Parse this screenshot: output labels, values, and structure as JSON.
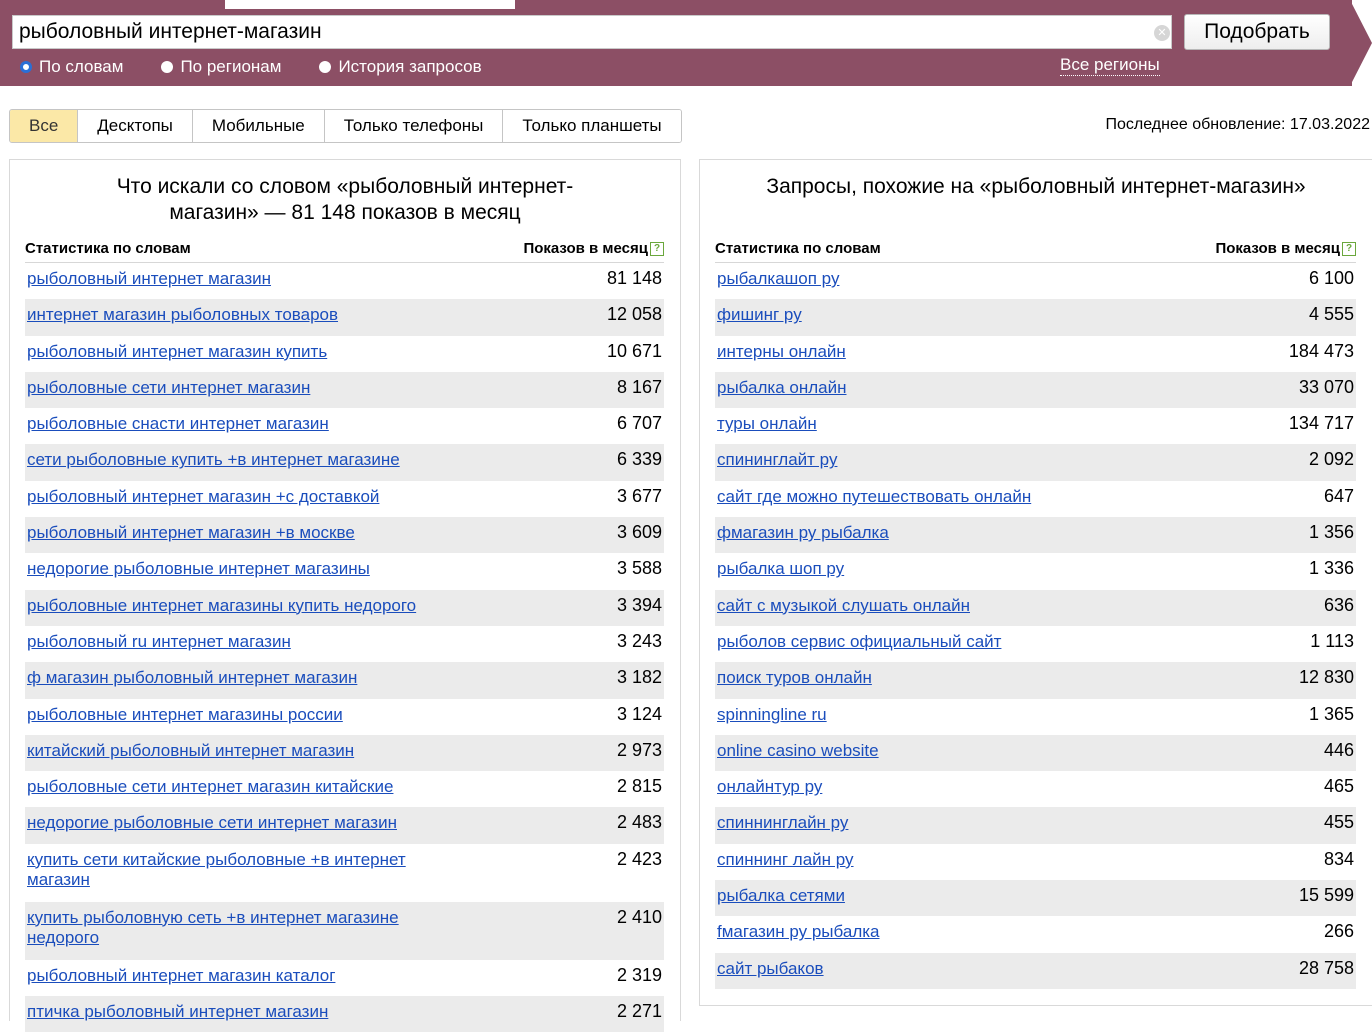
{
  "search": {
    "query": "рыболовный интернет-магазин",
    "submit_label": "Подобрать",
    "modes": [
      {
        "label": "По словам",
        "selected": true
      },
      {
        "label": "По регионам",
        "selected": false
      },
      {
        "label": "История запросов",
        "selected": false
      }
    ],
    "regions_label": "Все регионы"
  },
  "device_tabs": [
    {
      "label": "Все",
      "active": true
    },
    {
      "label": "Десктопы",
      "active": false
    },
    {
      "label": "Мобильные",
      "active": false
    },
    {
      "label": "Только телефоны",
      "active": false
    },
    {
      "label": "Только планшеты",
      "active": false
    }
  ],
  "last_update": "Последнее обновление: 17.03.2022",
  "left_panel": {
    "title": "Что искали со словом «рыболовный интернет-магазин» — 81 148 показов в месяц",
    "col_name": "Статистика по словам",
    "col_count": "Показов в месяц",
    "rows": [
      {
        "phrase": "рыболовный интернет магазин",
        "count": "81 148"
      },
      {
        "phrase": "интернет магазин рыболовных товаров",
        "count": "12 058"
      },
      {
        "phrase": "рыболовный интернет магазин купить",
        "count": "10 671"
      },
      {
        "phrase": "рыболовные сети интернет магазин",
        "count": "8 167"
      },
      {
        "phrase": "рыболовные снасти интернет магазин",
        "count": "6 707"
      },
      {
        "phrase": "сети рыболовные купить +в интернет магазине",
        "count": "6 339"
      },
      {
        "phrase": "рыболовный интернет магазин +с доставкой",
        "count": "3 677"
      },
      {
        "phrase": "рыболовный интернет магазин +в москве",
        "count": "3 609"
      },
      {
        "phrase": "недорогие рыболовные интернет магазины",
        "count": "3 588"
      },
      {
        "phrase": "рыболовные интернет магазины купить недорого",
        "count": "3 394"
      },
      {
        "phrase": "рыболовный ru интернет магазин",
        "count": "3 243"
      },
      {
        "phrase": "ф магазин рыболовный интернет магазин",
        "count": "3 182"
      },
      {
        "phrase": "рыболовные интернет магазины россии",
        "count": "3 124"
      },
      {
        "phrase": "китайский рыболовный интернет магазин",
        "count": "2 973"
      },
      {
        "phrase": "рыболовные сети интернет магазин китайские",
        "count": "2 815"
      },
      {
        "phrase": "недорогие рыболовные сети интернет магазин",
        "count": "2 483"
      },
      {
        "phrase": "купить сети китайские рыболовные +в интернет магазин",
        "count": "2 423"
      },
      {
        "phrase": "купить рыболовную сеть +в интернет магазине недорого",
        "count": "2 410"
      },
      {
        "phrase": "рыболовный интернет магазин каталог",
        "count": "2 319"
      },
      {
        "phrase": "птичка рыболовный интернет магазин",
        "count": "2 271"
      }
    ]
  },
  "right_panel": {
    "title": "Запросы, похожие на «рыболовный интернет-магазин»",
    "col_name": "Статистика по словам",
    "col_count": "Показов в месяц",
    "rows": [
      {
        "phrase": "рыбалкашоп ру",
        "count": "6 100"
      },
      {
        "phrase": "фишинг ру",
        "count": "4 555"
      },
      {
        "phrase": "интерны онлайн",
        "count": "184 473"
      },
      {
        "phrase": "рыбалка онлайн",
        "count": "33 070"
      },
      {
        "phrase": "туры онлайн",
        "count": "134 717"
      },
      {
        "phrase": "спининглайт ру",
        "count": "2 092"
      },
      {
        "phrase": "сайт где можно путешествовать онлайн",
        "count": "647"
      },
      {
        "phrase": "фмагазин ру рыбалка",
        "count": "1 356"
      },
      {
        "phrase": "рыбалка шоп ру",
        "count": "1 336"
      },
      {
        "phrase": "сайт с музыкой слушать онлайн",
        "count": "636"
      },
      {
        "phrase": "рыболов сервис официальный сайт",
        "count": "1 113"
      },
      {
        "phrase": "поиск туров онлайн",
        "count": "12 830"
      },
      {
        "phrase": "spinningline ru",
        "count": "1 365"
      },
      {
        "phrase": "online casino website",
        "count": "446"
      },
      {
        "phrase": "онлайнтур ру",
        "count": "465"
      },
      {
        "phrase": "спиннинглайн ру",
        "count": "455"
      },
      {
        "phrase": "спиннинг лайн ру",
        "count": "834"
      },
      {
        "phrase": "рыбалка сетями",
        "count": "15 599"
      },
      {
        "phrase": "fмагазин ру рыбалка",
        "count": "266"
      },
      {
        "phrase": "сайт рыбаков",
        "count": "28 758"
      }
    ]
  }
}
